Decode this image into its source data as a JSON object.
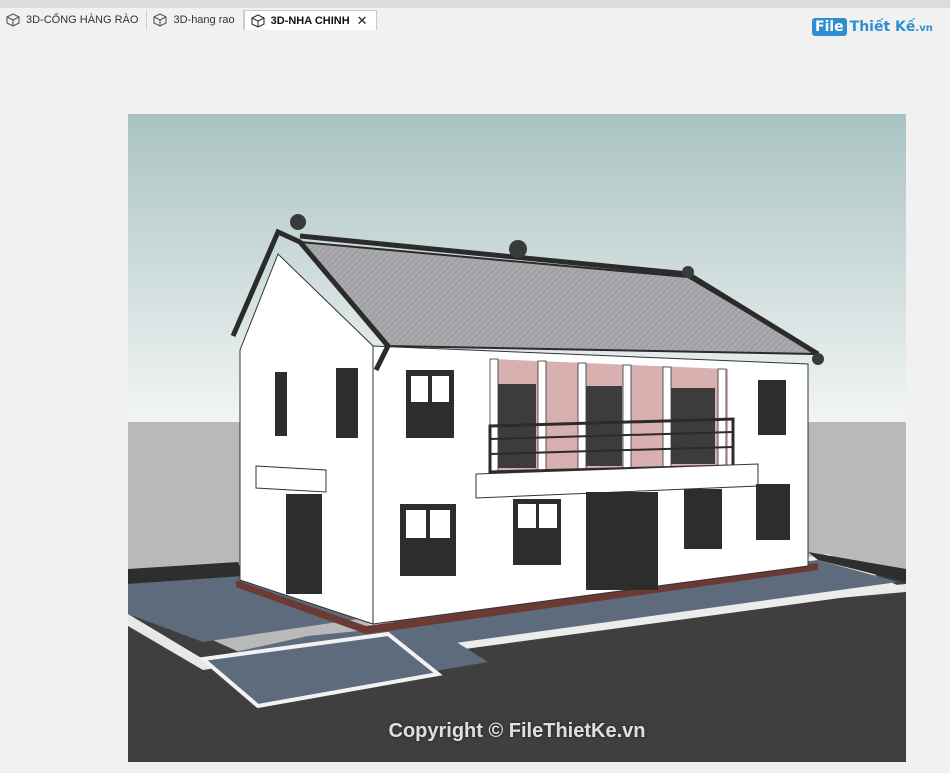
{
  "tabs": [
    {
      "label": "3D-CỔNG HÀNG RÀO",
      "active": false,
      "icon": "3d-view-icon"
    },
    {
      "label": "3D-hang rao",
      "active": false,
      "icon": "3d-view-icon"
    },
    {
      "label": "3D-NHA CHINH",
      "active": true,
      "icon": "3d-view-icon",
      "close": "✕"
    }
  ],
  "logo": {
    "badge": "File",
    "text": "Thiết Kế",
    "suffix": ".vn"
  },
  "watermark": "Copyright © FileThietKe.vn",
  "colors": {
    "sky_top": "#a9c3c2",
    "roof": "#a9a9ad",
    "wall": "#ffffff",
    "accent_pink": "#c98f8f",
    "pavement": "#5d6b7c"
  }
}
